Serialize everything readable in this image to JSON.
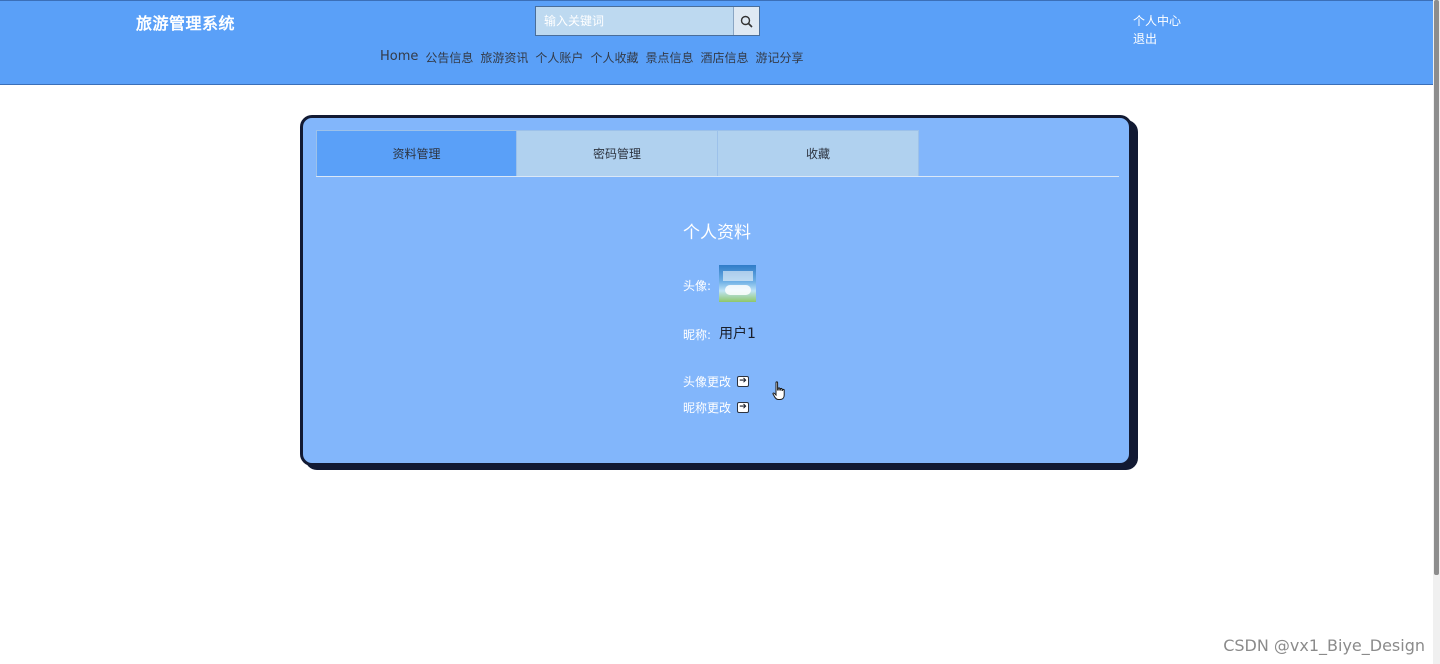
{
  "header": {
    "site_title": "旅游管理系统",
    "search_placeholder": "输入关键词",
    "search_icon": "search-icon",
    "nav": [
      {
        "label": "Home"
      },
      {
        "label": "公告信息"
      },
      {
        "label": "旅游资讯"
      },
      {
        "label": "个人账户"
      },
      {
        "label": "个人收藏"
      },
      {
        "label": "景点信息"
      },
      {
        "label": "酒店信息"
      },
      {
        "label": "游记分享"
      }
    ],
    "user_links": {
      "center": "个人中心",
      "logout": "退出"
    }
  },
  "tabs": [
    {
      "label": "资料管理",
      "active": true
    },
    {
      "label": "密码管理",
      "active": false
    },
    {
      "label": "收藏",
      "active": false
    }
  ],
  "profile": {
    "title": "个人资料",
    "avatar_label": "头像:",
    "nickname_label": "昵称:",
    "nickname_value": "用户1",
    "change_avatar": "头像更改",
    "change_nickname": "昵称更改",
    "action_icon": "arrow-right-box-icon"
  },
  "colors": {
    "header_bg": "#5aa0f8",
    "card_bg": "#82b6fb",
    "tab_active": "#5aa0f8",
    "tab_inactive": "#b0d1ef",
    "card_border": "#121a33"
  },
  "watermark": "CSDN @vx1_Biye_Design"
}
